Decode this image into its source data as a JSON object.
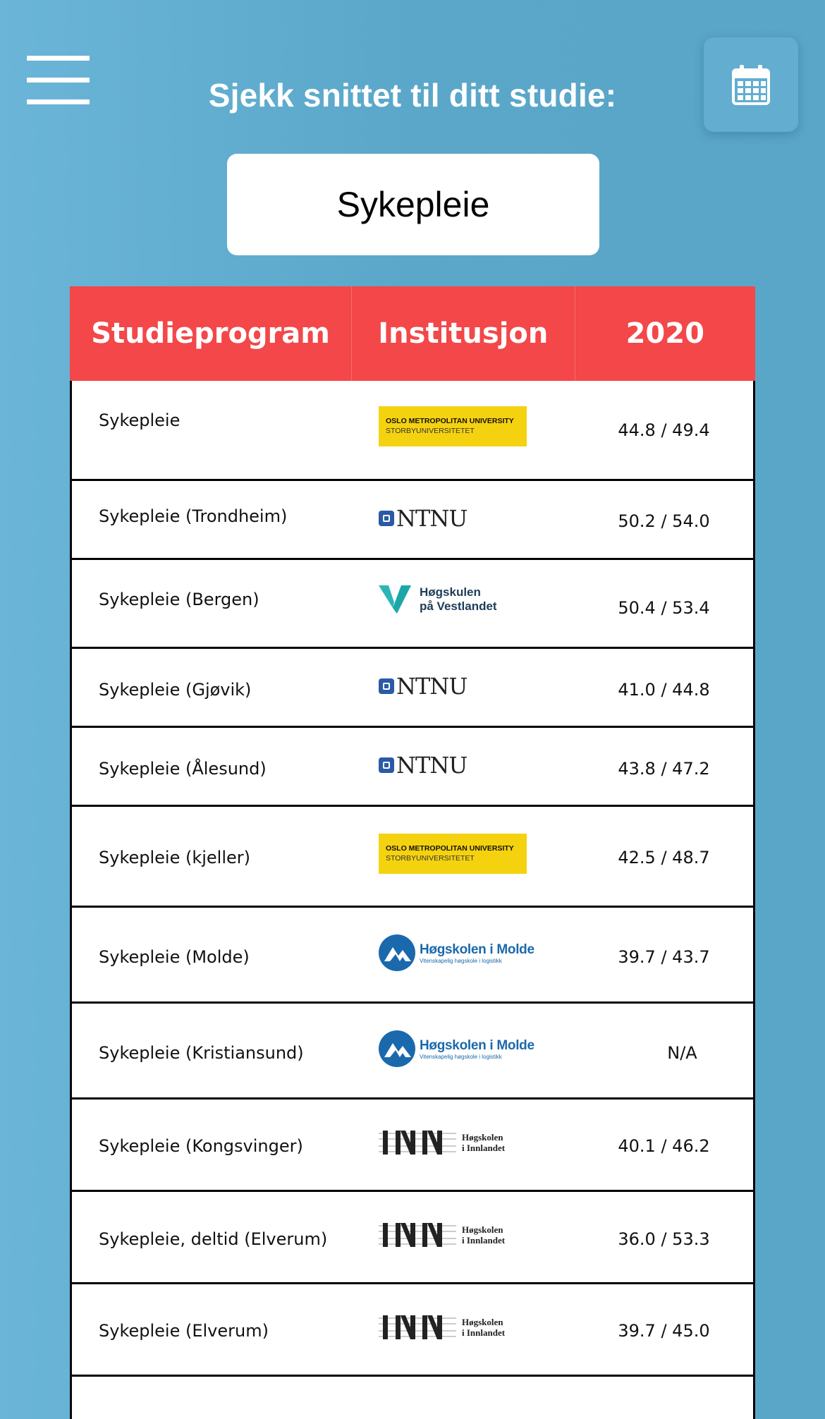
{
  "header": {
    "title": "Sjekk snittet til ditt studie:",
    "menu_icon": "hamburger-menu-icon",
    "calendar_icon": "calendar-icon"
  },
  "search": {
    "selected_program": "Sykepleie"
  },
  "table": {
    "header_color": "#f34749",
    "columns": [
      "Studieprogram",
      "Institusjon",
      "2020"
    ],
    "rows": [
      {
        "program": "Sykepleie",
        "institution": "OsloMet",
        "institution_logo_text": [
          "OSLO METROPOLITAN UNIVERSITY",
          "STORBYUNIVERSITETET"
        ],
        "score": "44.8 / 49.4"
      },
      {
        "program": "Sykepleie (Trondheim)",
        "institution": "NTNU",
        "institution_logo_text": [
          "NTNU"
        ],
        "score": "50.2 / 54.0"
      },
      {
        "program": "Sykepleie (Bergen)",
        "institution": "HVL",
        "institution_logo_text": [
          "Høgskulen",
          "på Vestlandet"
        ],
        "score": "50.4 / 53.4"
      },
      {
        "program": "Sykepleie (Gjøvik)",
        "institution": "NTNU",
        "institution_logo_text": [
          "NTNU"
        ],
        "score": "41.0 / 44.8"
      },
      {
        "program": "Sykepleie (Ålesund)",
        "institution": "NTNU",
        "institution_logo_text": [
          "NTNU"
        ],
        "score": "43.8 / 47.2"
      },
      {
        "program": "Sykepleie (kjeller)",
        "institution": "OsloMet",
        "institution_logo_text": [
          "OSLO METROPOLITAN UNIVERSITY",
          "STORBYUNIVERSITETET"
        ],
        "score": "42.5 / 48.7"
      },
      {
        "program": "Sykepleie (Molde)",
        "institution": "Molde",
        "institution_logo_text": [
          "Høgskolen i Molde",
          "Vitenskapelig høgskole i logistikk"
        ],
        "score": "39.7 / 43.7"
      },
      {
        "program": "Sykepleie (Kristiansund)",
        "institution": "Molde",
        "institution_logo_text": [
          "Høgskolen i Molde",
          "Vitenskapelig høgskole i logistikk"
        ],
        "score": "N/A"
      },
      {
        "program": "Sykepleie (Kongsvinger)",
        "institution": "INN",
        "institution_logo_text": [
          "Høgskolen",
          "i Innlandet"
        ],
        "score": "40.1 / 46.2"
      },
      {
        "program": "Sykepleie, deltid (Elverum)",
        "institution": "INN",
        "institution_logo_text": [
          "Høgskolen",
          "i Innlandet"
        ],
        "score": "36.0 / 53.3"
      },
      {
        "program": "Sykepleie (Elverum)",
        "institution": "INN",
        "institution_logo_text": [
          "Høgskolen",
          "i Innlandet"
        ],
        "score": "39.7 / 45.0"
      }
    ]
  }
}
